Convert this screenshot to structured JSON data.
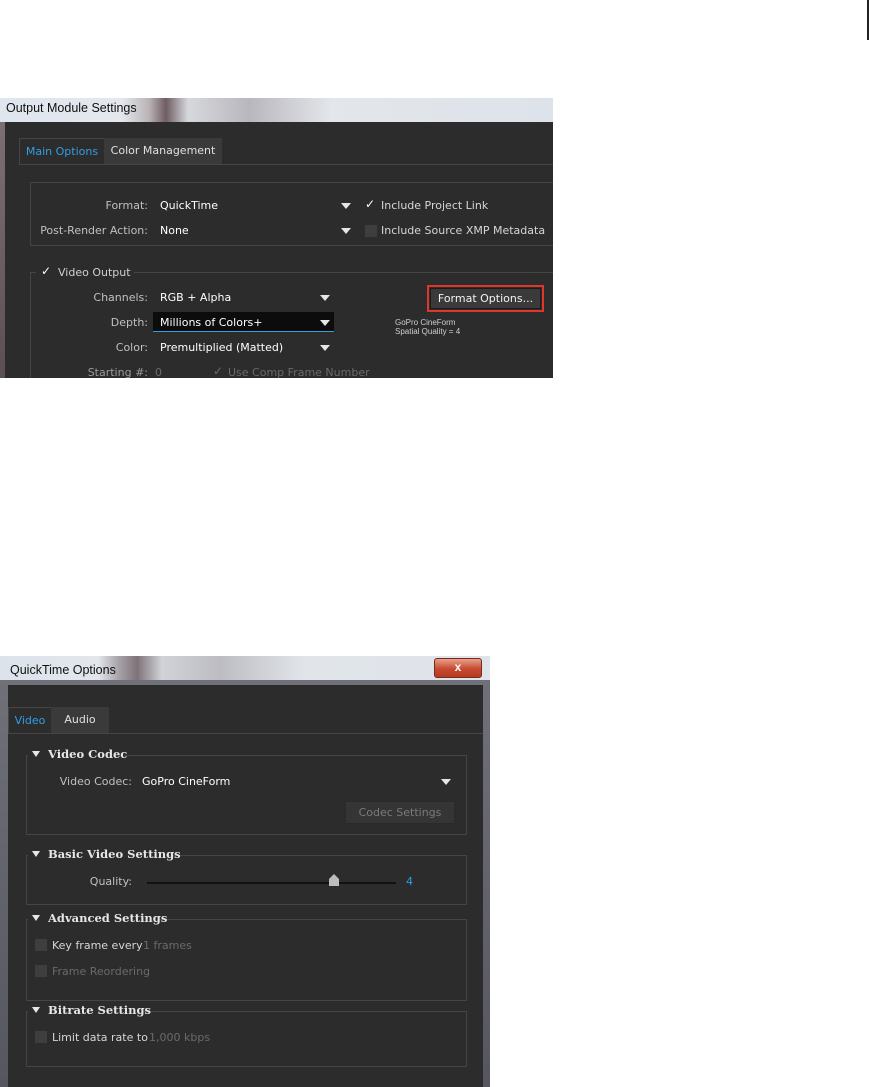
{
  "output_module": {
    "title": "Output Module Settings",
    "tabs": [
      {
        "label": "Main Options",
        "active": true
      },
      {
        "label": "Color Management",
        "active": false
      }
    ],
    "format_label": "Format:",
    "format_value": "QuickTime",
    "include_project_link": {
      "label": "Include Project Link",
      "checked": true
    },
    "post_render_label": "Post-Render Action:",
    "post_render_value": "None",
    "include_xmp": {
      "label": "Include Source XMP Metadata",
      "checked": false
    },
    "video_output": {
      "label": "Video Output",
      "checked": true
    },
    "channels_label": "Channels:",
    "channels_value": "RGB + Alpha",
    "depth_label": "Depth:",
    "depth_value": "Millions of Colors+",
    "color_label": "Color:",
    "color_value": "Premultiplied (Matted)",
    "starting_label": "Starting #:",
    "starting_value": "0",
    "use_comp_frame": {
      "label": "Use Comp Frame Number",
      "checked": true
    },
    "format_options_button": "Format Options...",
    "codec_info_line1": "GoPro CineForm",
    "codec_info_line2": "Spatial Quality = 4",
    "highlight_color": "#e0352b"
  },
  "quicktime": {
    "title": "QuickTime Options",
    "close_label": "x",
    "tabs": [
      {
        "label": "Video",
        "active": true
      },
      {
        "label": "Audio",
        "active": false
      }
    ],
    "video_codec_section": "Video Codec",
    "video_codec_label": "Video Codec:",
    "video_codec_value": "GoPro CineForm",
    "codec_settings_button": "Codec Settings",
    "basic_section": "Basic Video Settings",
    "quality_label": "Quality:",
    "quality_value": "4",
    "quality_fraction": 0.75,
    "advanced_section": "Advanced Settings",
    "key_frame_label": "Key frame every",
    "key_frame_value": "1 frames",
    "frame_reordering_label": "Frame Reordering",
    "bitrate_section": "Bitrate Settings",
    "limit_rate_label": "Limit data rate to",
    "limit_rate_value": "1,000",
    "limit_rate_unit": "kbps"
  },
  "accent_color": "#2f9fe6"
}
